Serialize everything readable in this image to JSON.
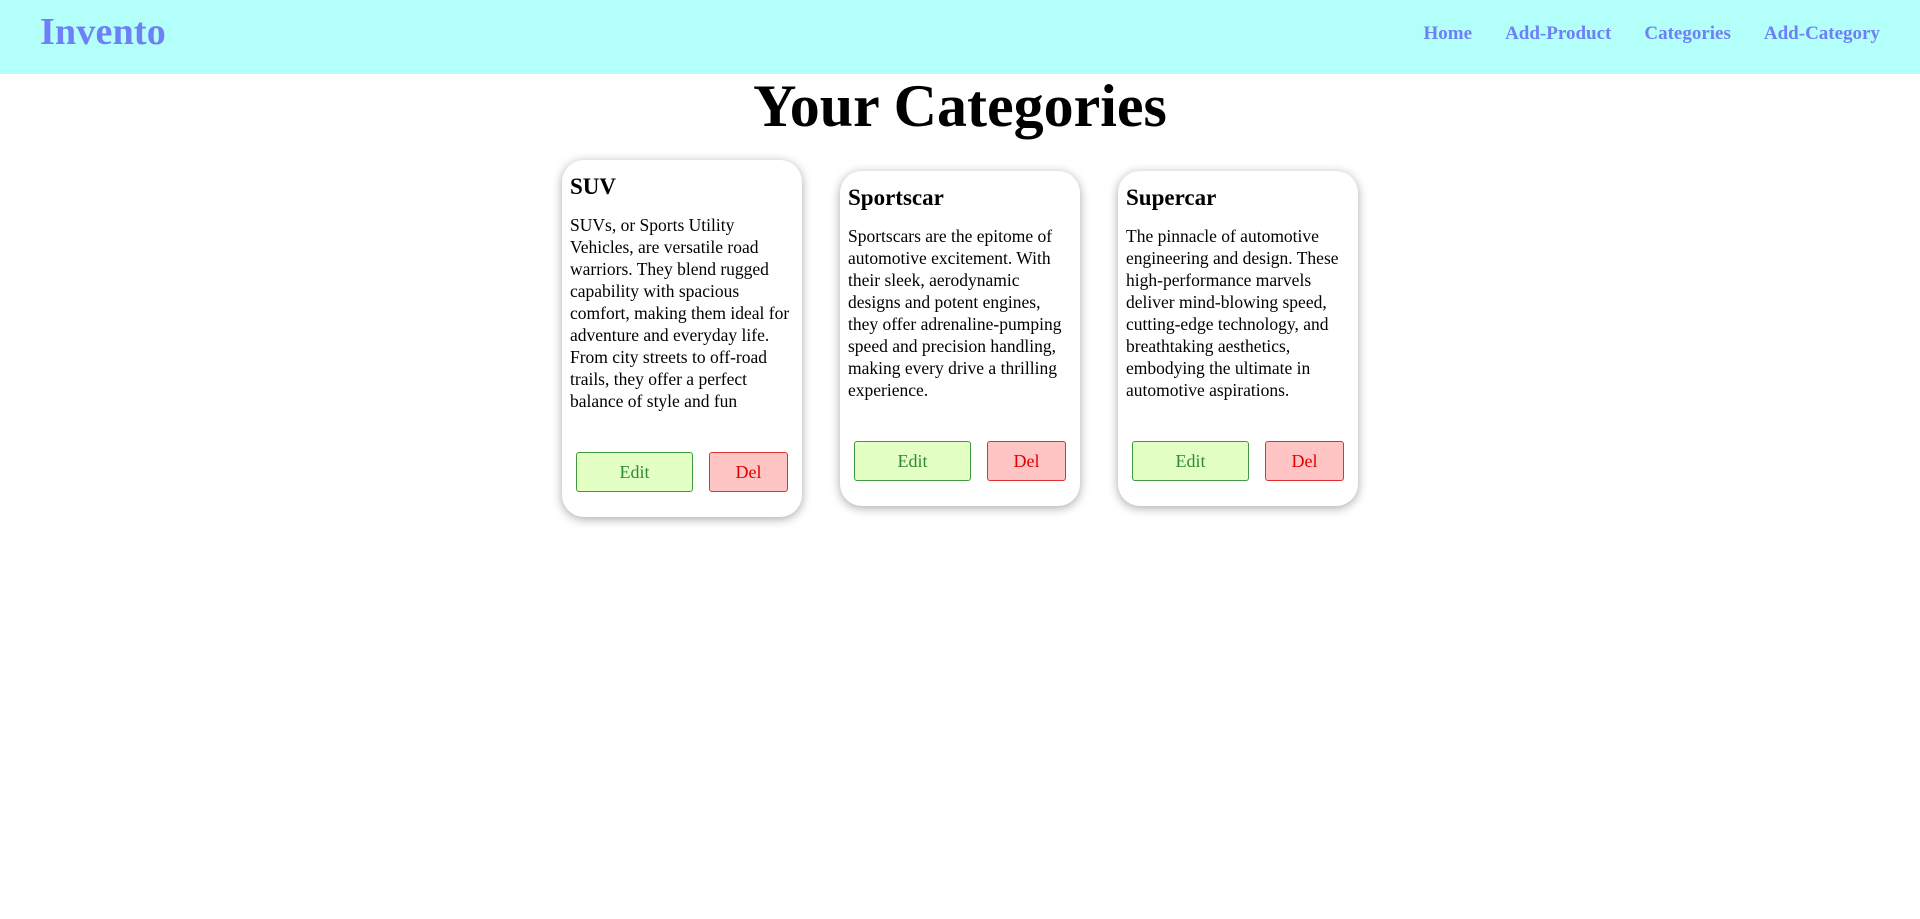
{
  "navbar": {
    "brand": "Invento",
    "links": [
      "Home",
      "Add-Product",
      "Categories",
      "Add-Category"
    ]
  },
  "page": {
    "title": "Your Categories"
  },
  "categories": [
    {
      "name": "SUV",
      "description": "SUVs, or Sports Utility Vehicles, are versatile road warriors. They blend rugged capability with spacious comfort, making them ideal for adventure and everyday life. From city streets to off-road trails, they offer a perfect balance of style and fun",
      "edit_label": "Edit",
      "delete_label": "Del"
    },
    {
      "name": "Sportscar",
      "description": "Sportscars are the epitome of automotive excitement. With their sleek, aerodynamic designs and potent engines, they offer adrenaline-pumping speed and precision handling, making every drive a thrilling experience.",
      "edit_label": "Edit",
      "delete_label": "Del"
    },
    {
      "name": "Supercar",
      "description": "The pinnacle of automotive engineering and design. These high-performance marvels deliver mind-blowing speed, cutting-edge technology, and breathtaking aesthetics, embodying the ultimate in automotive aspirations.",
      "edit_label": "Edit",
      "delete_label": "Del"
    }
  ],
  "colors": {
    "navbar_bg": "#b3fffa",
    "brand": "#6f7ff7",
    "edit_bg": "#e4ffc4",
    "edit_text": "#2f8a2f",
    "delete_bg": "#ffc4c4",
    "delete_text": "#e00000"
  }
}
